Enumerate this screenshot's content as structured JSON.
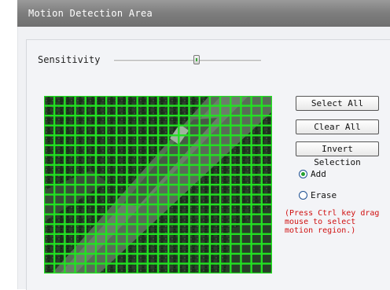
{
  "window": {
    "title": "Motion Detection Area"
  },
  "sensitivity": {
    "label": "Sensitivity",
    "level_fraction": 0.56
  },
  "buttons": {
    "select_all": "Select All",
    "clear_all": "Clear All",
    "invert_selection": "Invert Selection"
  },
  "mode": {
    "options": [
      {
        "label": "Add",
        "selected": true
      },
      {
        "label": "Erase",
        "selected": false
      }
    ]
  },
  "hint": {
    "text": "(Press Ctrl key drag mouse to select motion region.)"
  },
  "grid": {
    "columns": 22,
    "rows": 18,
    "all_selected": true,
    "line_color": "#22e022"
  },
  "colors": {
    "accent_red": "#d01010",
    "radio_fill": "#24a12f"
  }
}
